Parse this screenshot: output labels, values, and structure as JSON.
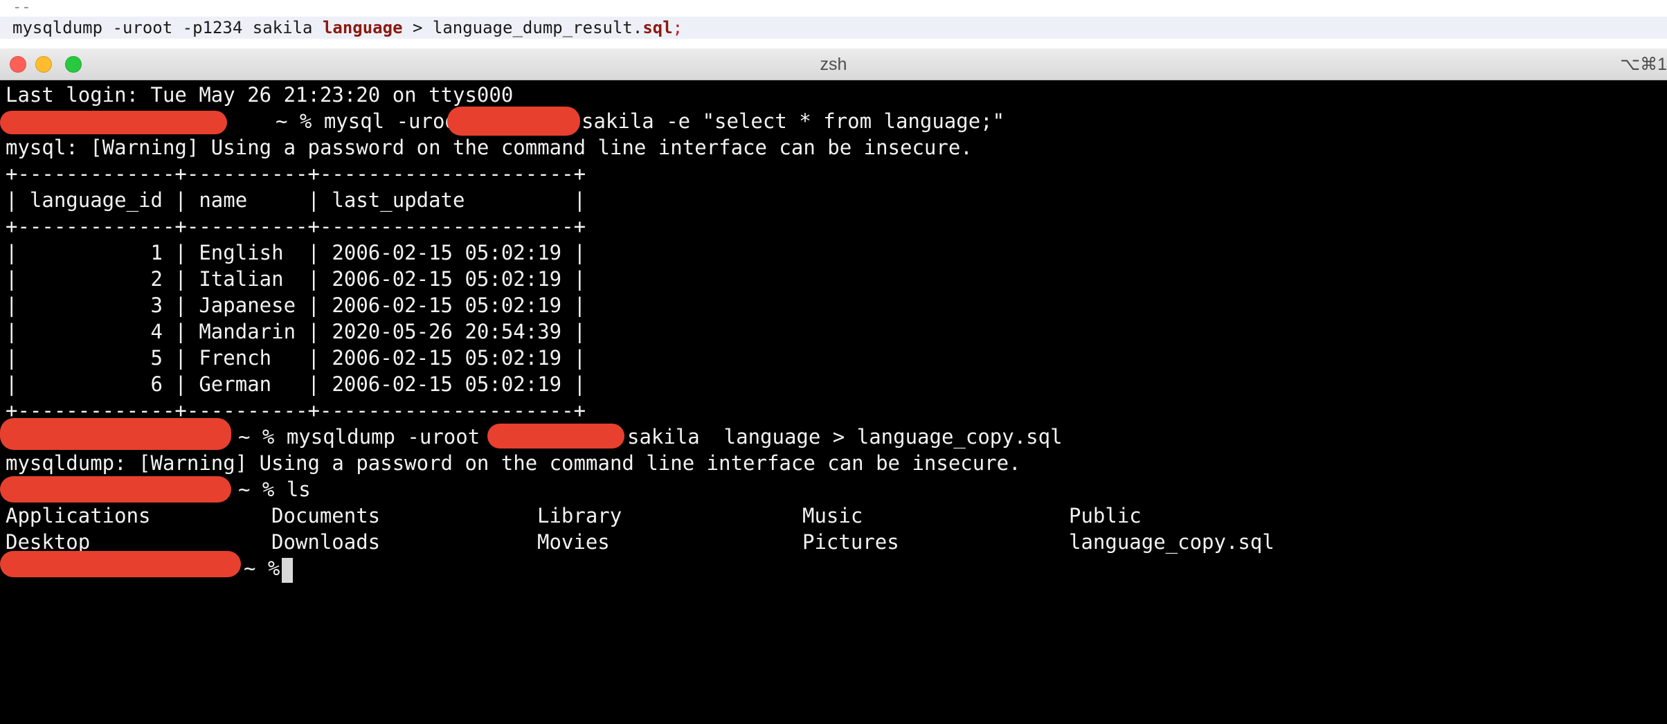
{
  "editor": {
    "comment": "--",
    "code_prefix": "mysqldump -uroot -p1234 sakila ",
    "code_keyword1": "language",
    "code_mid": " > language_dump_result.",
    "code_keyword2": "sql",
    "code_semicolon": ";"
  },
  "window": {
    "title": "zsh",
    "shortcut": "⌥⌘1"
  },
  "terminal": {
    "last_login": "Last login: Tue May 26 21:23:20 on ttys000",
    "cmd1_prompt": "~ % mysql -uroot -p",
    "cmd1_rest": "sakila -e \"select * from language;\"",
    "warning1": "mysql: [Warning] Using a password on the command line interface can be insecure.",
    "table_border": "+-------------+----------+---------------------+",
    "table_header": "| language_id | name     | last_update         |",
    "table_rows": [
      "|           1 | English  | 2006-02-15 05:02:19 |",
      "|           2 | Italian  | 2006-02-15 05:02:19 |",
      "|           3 | Japanese | 2006-02-15 05:02:19 |",
      "|           4 | Mandarin | 2020-05-26 20:54:39 |",
      "|           5 | French   | 2006-02-15 05:02:19 |",
      "|           6 | German   | 2006-02-15 05:02:19 |"
    ],
    "cmd2_prompt": "~ % mysqldump -uroot -p",
    "cmd2_rest": "sakila  language > language_copy.sql",
    "warning2": "mysqldump: [Warning] Using a password on the command line interface can be insecure.",
    "cmd3": "~ % ls",
    "ls_items": [
      "Applications",
      "Documents",
      "Library",
      "Music",
      "Public",
      "Desktop",
      "Downloads",
      "Movies",
      "Pictures",
      "language_copy.sql"
    ],
    "prompt_final": "~ %"
  }
}
